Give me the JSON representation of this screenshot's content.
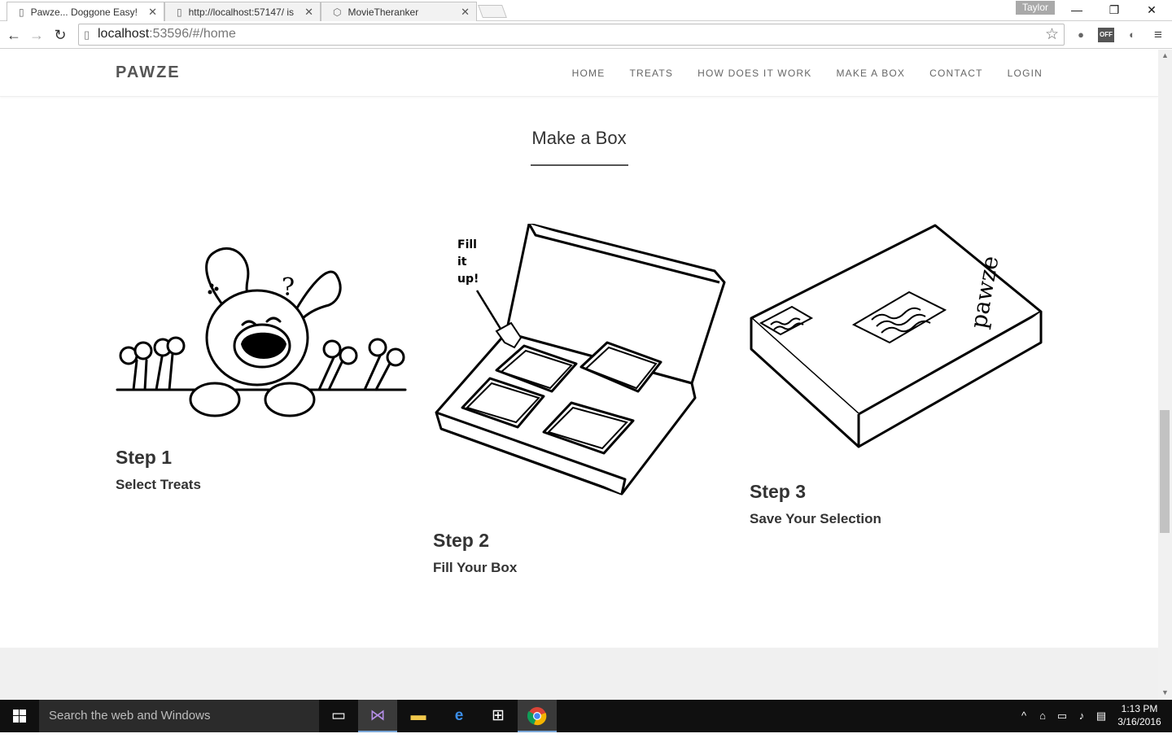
{
  "browser": {
    "tabs": [
      {
        "label": "Pawze... Doggone Easy!",
        "active": true
      },
      {
        "label": "http://localhost:57147/ is",
        "active": false
      },
      {
        "label": "MovieTheranker",
        "active": false
      }
    ],
    "user": "Taylor",
    "url_host": "localhost",
    "url_rest": ":53596/#/home",
    "ext_off_label": "OFF"
  },
  "site": {
    "brand": "PAWZE",
    "menu": [
      "HOME",
      "TREATS",
      "HOW DOES IT WORK",
      "MAKE A BOX",
      "CONTACT",
      "LOGIN"
    ]
  },
  "section": {
    "title": "Make a Box",
    "steps": [
      {
        "name": "Step 1",
        "desc": "Select Treats"
      },
      {
        "name": "Step 2",
        "desc": "Fill Your Box",
        "callout": [
          "Fill",
          "it",
          "up!"
        ]
      },
      {
        "name": "Step 3",
        "desc": "Save Your Selection",
        "box_brand": "pawze"
      }
    ]
  },
  "taskbar": {
    "search_placeholder": "Search the web and Windows",
    "time": "1:13 PM",
    "date": "3/16/2016"
  },
  "colors": {
    "taskbar": "#101010",
    "search": "#2b2b2b",
    "nav_text": "#666666",
    "title": "#333333"
  }
}
